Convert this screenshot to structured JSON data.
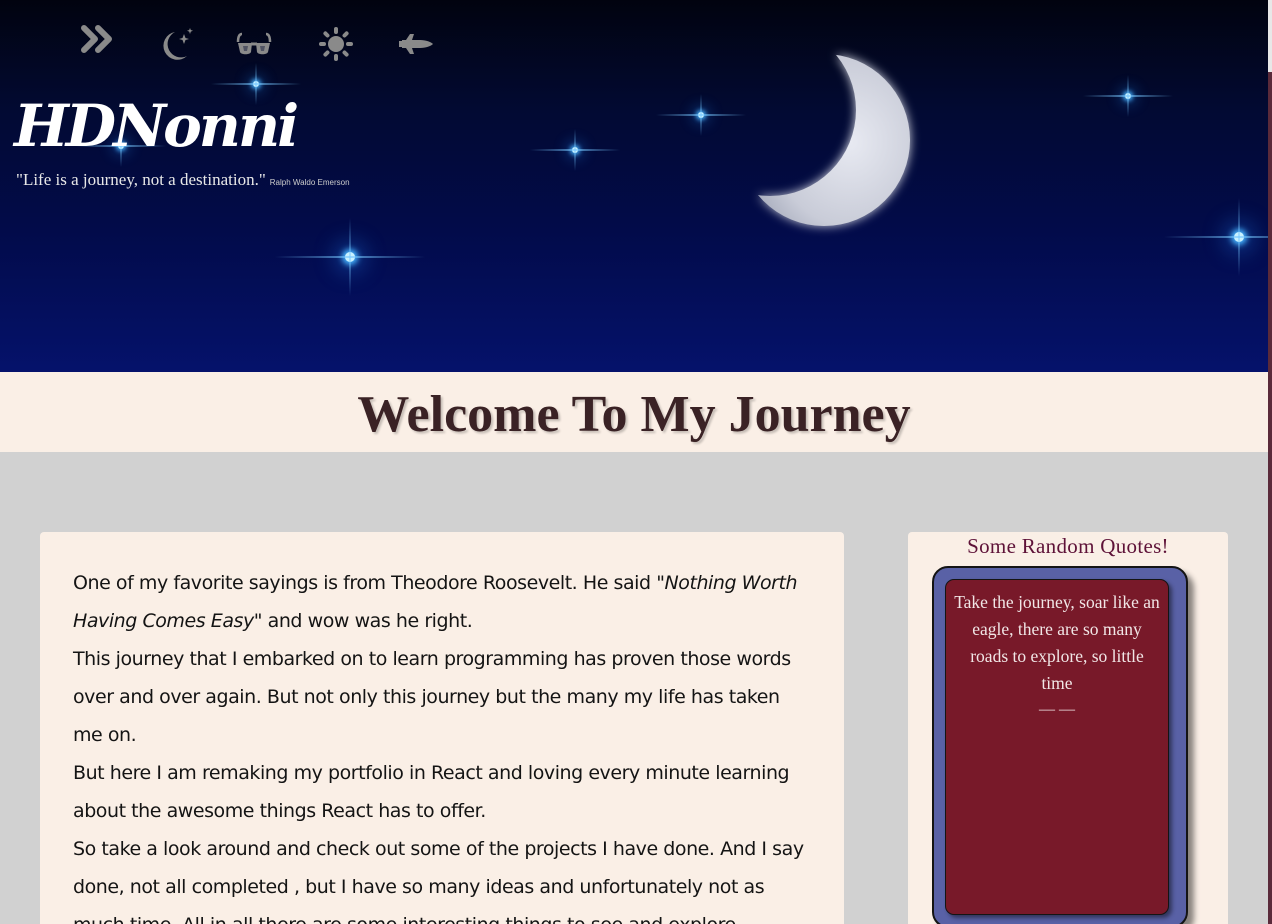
{
  "header": {
    "brand": "HDNonni",
    "quote": "\"Life is a journey, not a destination.\"",
    "quote_author": "Ralph Waldo Emerson",
    "nav": [
      {
        "icon": "chevrons-right-icon"
      },
      {
        "icon": "moon-stars-icon"
      },
      {
        "icon": "sunglasses-icon"
      },
      {
        "icon": "sun-icon"
      },
      {
        "icon": "space-shuttle-icon"
      }
    ]
  },
  "welcome": {
    "title": "Welcome To My Journey"
  },
  "intro": {
    "p1_before": "One of my favorite sayings is from Theodore Roosevelt. He said ",
    "p1_quote": "\"Nothing Worth Having Comes Easy\"",
    "p1_after": " and wow was he right.",
    "p2": "This journey that I embarked on to learn programming has proven those words over and over again. But not only this journey but the many my life has taken me on.",
    "p3": "But here I am remaking my portfolio in React and loving every minute learning about the awesome things React has to offer.",
    "p4": "So take a look around and check out some of the projects I have done. And I say done, not all completed , but I have so many ideas and unfortunately not as much time. All in all there are some interesting things to see and explore."
  },
  "quotes": {
    "title": "Some Random Quotes!",
    "text": "Take the journey, soar like an eagle, there are so many roads to explore, so little time",
    "attribution": "— —"
  },
  "colors": {
    "hero_bg": "#020b4a",
    "cream": "#faefe6",
    "page_bg": "#d1d1d1",
    "quote_frame": "#5961a6",
    "quote_card": "#781929",
    "quotes_title": "#5e1238"
  }
}
